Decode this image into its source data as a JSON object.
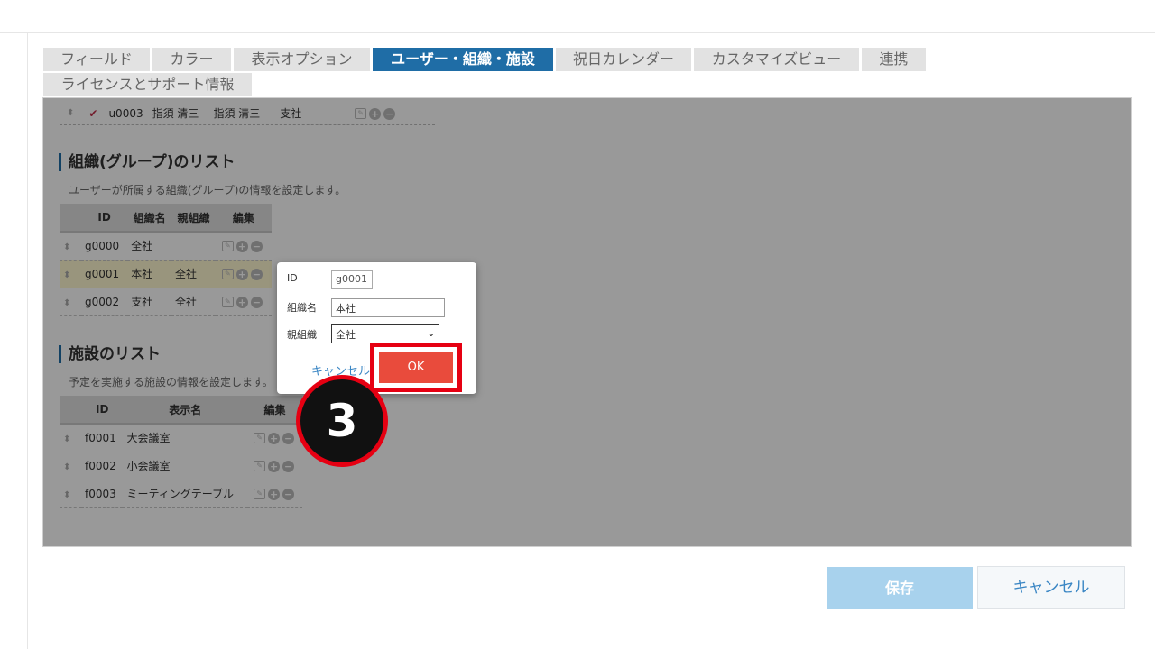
{
  "tabs": [
    {
      "label": "フィールド"
    },
    {
      "label": "カラー"
    },
    {
      "label": "表示オプション"
    },
    {
      "label": "ユーザー・組織・施設"
    },
    {
      "label": "祝日カレンダー"
    },
    {
      "label": "カスタマイズビュー"
    },
    {
      "label": "連携"
    },
    {
      "label": "ライセンスとサポート情報"
    }
  ],
  "active_tab": "ユーザー・組織・施設",
  "user_row": {
    "id": "u0003",
    "name": "指須 清三",
    "display": "指須 清三",
    "org": "支社"
  },
  "groups": {
    "title": "組織(グループ)のリスト",
    "description": "ユーザーが所属する組織(グループ)の情報を設定します。",
    "headers": {
      "id": "ID",
      "name": "組織名",
      "parent": "親組織",
      "edit": "編集"
    },
    "rows": [
      {
        "id": "g0000",
        "name": "全社",
        "parent": ""
      },
      {
        "id": "g0001",
        "name": "本社",
        "parent": "全社"
      },
      {
        "id": "g0002",
        "name": "支社",
        "parent": "全社"
      }
    ]
  },
  "facilities": {
    "title": "施設のリスト",
    "description": "予定を実施する施設の情報を設定します。",
    "headers": {
      "id": "ID",
      "name": "表示名",
      "edit": "編集"
    },
    "rows": [
      {
        "id": "f0001",
        "name": "大会議室"
      },
      {
        "id": "f0002",
        "name": "小会議室"
      },
      {
        "id": "f0003",
        "name": "ミーティングテーブル"
      }
    ]
  },
  "dialog": {
    "id_label": "ID",
    "id_value": "g0001",
    "name_label": "組織名",
    "name_value": "本社",
    "parent_label": "親組織",
    "parent_value": "全社",
    "cancel_label": "キャンセル",
    "ok_label": "OK"
  },
  "step_number": "3",
  "footer": {
    "save_label": "保存",
    "cancel_label": "キャンセル"
  },
  "colors": {
    "accent": "#1f6da6",
    "ok": "#e94b3c",
    "highlight": "#e60012",
    "save": "#a8d2ed"
  }
}
